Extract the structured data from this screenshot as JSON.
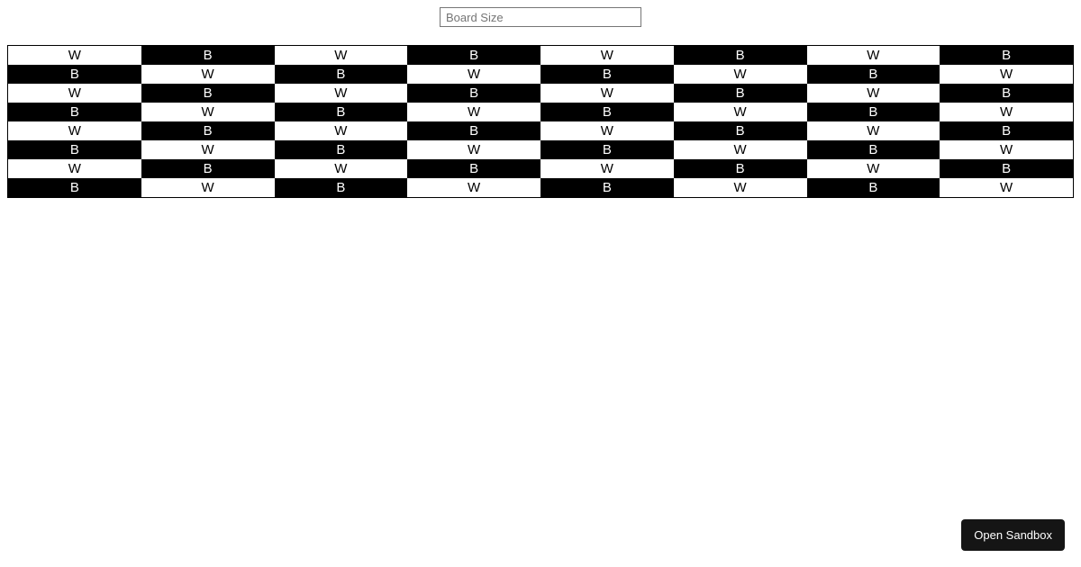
{
  "input": {
    "placeholder": "Board Size",
    "value": ""
  },
  "board": {
    "size": 8,
    "whiteLabel": "W",
    "blackLabel": "B"
  },
  "sandbox": {
    "label": "Open Sandbox"
  }
}
